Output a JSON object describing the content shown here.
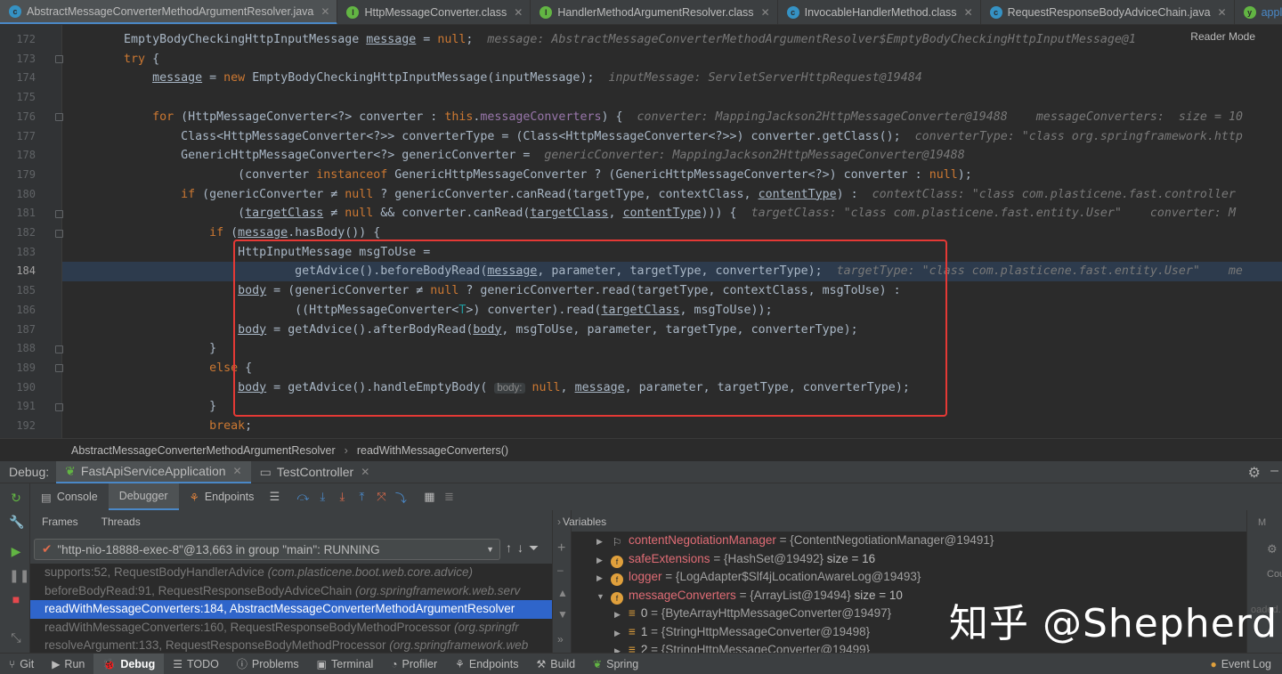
{
  "tabs": [
    {
      "label": "AbstractMessageConverterMethodArgumentResolver.java",
      "icon": "java-class-icon",
      "color": "#3592c4",
      "active": true
    },
    {
      "label": "HttpMessageConverter.class",
      "icon": "interface-icon",
      "color": "#62b543",
      "active": false
    },
    {
      "label": "HandlerMethodArgumentResolver.class",
      "icon": "interface-icon",
      "color": "#62b543",
      "active": false
    },
    {
      "label": "InvocableHandlerMethod.class",
      "icon": "class-icon",
      "color": "#3592c4",
      "active": false
    },
    {
      "label": "RequestResponseBodyAdviceChain.java",
      "icon": "class-icon",
      "color": "#3592c4",
      "active": false
    },
    {
      "label": "application-test.yr",
      "icon": "yaml-icon",
      "color": "#62b543",
      "active": false
    }
  ],
  "editor": {
    "reader_mode": "Reader Mode",
    "current_line": 184,
    "line_numbers": [
      "172",
      "173",
      "174",
      "175",
      "176",
      "177",
      "178",
      "179",
      "180",
      "181",
      "182",
      "183",
      "184",
      "185",
      "186",
      "187",
      "188",
      "189",
      "190",
      "191",
      "192"
    ]
  },
  "breadcrumb": {
    "class": "AbstractMessageConverterMethodArgumentResolver",
    "method": "readWithMessageConverters()"
  },
  "debug": {
    "label": "Debug:",
    "tabs": [
      {
        "label": "FastApiServiceApplication",
        "active": true
      },
      {
        "label": "TestController",
        "active": false
      }
    ],
    "subtabs": [
      "Console",
      "Debugger",
      "Endpoints"
    ],
    "frames_label": "Frames",
    "threads_label": "Threads",
    "variables_label": "Variables",
    "thread": "\"http-nio-18888-exec-8\"@13,663 in group \"main\": RUNNING",
    "frames": [
      {
        "method": "supports:52, RequestBodyHandlerAdvice",
        "pkg": "(com.plasticene.boot.web.core.advice)",
        "selected": false
      },
      {
        "method": "beforeBodyRead:91, RequestResponseBodyAdviceChain",
        "pkg": "(org.springframework.web.serv",
        "selected": false
      },
      {
        "method": "readWithMessageConverters:184, AbstractMessageConverterMethodArgumentResolver",
        "pkg": "",
        "selected": true
      },
      {
        "method": "readWithMessageConverters:160, RequestResponseBodyMethodProcessor",
        "pkg": "(org.springfr",
        "selected": false
      },
      {
        "method": "resolveArgument:133, RequestResponseBodyMethodProcessor",
        "pkg": "(org.springframework.web",
        "selected": false
      }
    ],
    "variables": [
      {
        "name": "contentNegotiationManager",
        "value": "= {ContentNegotiationManager@19491}",
        "size": ""
      },
      {
        "name": "safeExtensions",
        "value": "= {HashSet@19492}",
        "size": "size = 16"
      },
      {
        "name": "logger",
        "value": "= {LogAdapter$Slf4jLocationAwareLog@19493}",
        "size": ""
      },
      {
        "name": "messageConverters",
        "value": "= {ArrayList@19494}",
        "size": "size = 10"
      }
    ],
    "children": [
      {
        "index": "0",
        "value": "= {ByteArrayHttpMessageConverter@19497}"
      },
      {
        "index": "1",
        "value": "= {StringHttpMessageConverter@19498}"
      },
      {
        "index": "2",
        "value": "= {StringHttpMessageConverter@19499}"
      }
    ],
    "right_fragments": {
      "m": "M",
      "cou": "Cou",
      "loaded": "oaded."
    }
  },
  "watermark": "知乎 @Shepherd",
  "statusbar": {
    "items": [
      "Git",
      "Run",
      "Debug",
      "TODO",
      "Problems",
      "Terminal",
      "Profiler",
      "Endpoints",
      "Build",
      "Spring"
    ],
    "active": "Debug",
    "event_log": "Event Log"
  }
}
